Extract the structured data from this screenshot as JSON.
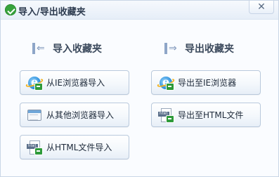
{
  "window": {
    "title": "导入/导出收藏夹",
    "close_symbol": "✕"
  },
  "import": {
    "header": "导入收藏夹",
    "buttons": [
      {
        "label": "从IE浏览器导入",
        "icon": "ie-icon"
      },
      {
        "label": "从其他浏览器导入",
        "icon": "browser-window-icon"
      },
      {
        "label": "从HTML文件导入",
        "icon": "html-file-icon"
      }
    ]
  },
  "export": {
    "header": "导出收藏夹",
    "buttons": [
      {
        "label": "导出至IE浏览器",
        "icon": "ie-icon"
      },
      {
        "label": "导出至HTML文件",
        "icon": "html-file-icon"
      }
    ]
  },
  "colors": {
    "accent_green": "#36a33c",
    "section_icon": "#8ea6c8",
    "button_border": "#b9c9dc"
  }
}
